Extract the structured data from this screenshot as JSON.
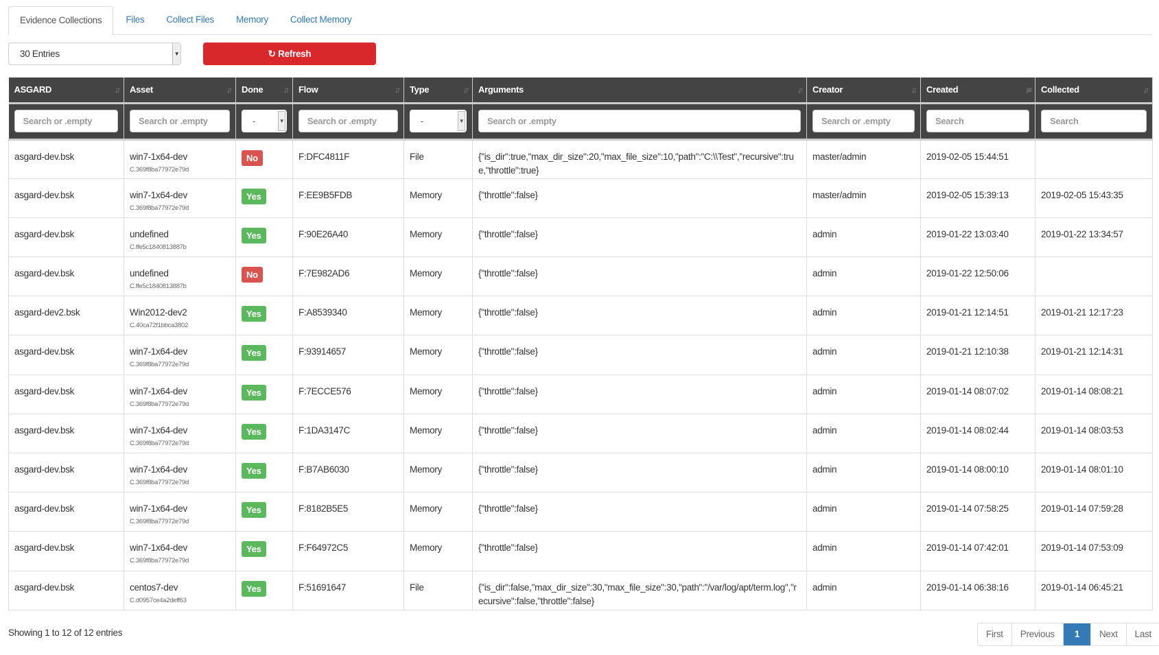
{
  "tabs": [
    "Evidence Collections",
    "Files",
    "Collect Files",
    "Memory",
    "Collect Memory"
  ],
  "entries_select": "30 Entries",
  "refresh_label": "Refresh",
  "columns": [
    "ASGARD",
    "Asset",
    "Done",
    "Flow",
    "Type",
    "Arguments",
    "Creator",
    "Created",
    "Collected"
  ],
  "filters": [
    "Search or .empty",
    "Search or .empty",
    "-",
    "Search or .empty",
    "-",
    "Search or .empty",
    "Search or .empty",
    "Search",
    "Search"
  ],
  "rows": [
    {
      "asgard": "asgard-dev.bsk",
      "asset": "win7-1x64-dev",
      "client": "C.369f8ba77972e79d",
      "done": "No",
      "flow": "F:DFC4811F",
      "type": "File",
      "args": "{\"is_dir\":true,\"max_dir_size\":20,\"max_file_size\":10,\"path\":\"C:\\\\Test\",\"recursive\":true,\"throttle\":true}",
      "creator": "master/admin",
      "created": "2019-02-05 15:44:51",
      "collected": ""
    },
    {
      "asgard": "asgard-dev.bsk",
      "asset": "win7-1x64-dev",
      "client": "C.369f8ba77972e79d",
      "done": "Yes",
      "flow": "F:EE9B5FDB",
      "type": "Memory",
      "args": "{\"throttle\":false}",
      "creator": "master/admin",
      "created": "2019-02-05 15:39:13",
      "collected": "2019-02-05 15:43:35"
    },
    {
      "asgard": "asgard-dev.bsk",
      "asset": "undefined",
      "client": "C.ffe5c1840813887b",
      "done": "Yes",
      "flow": "F:90E26A40",
      "type": "Memory",
      "args": "{\"throttle\":false}",
      "creator": "admin",
      "created": "2019-01-22 13:03:40",
      "collected": "2019-01-22 13:34:57"
    },
    {
      "asgard": "asgard-dev.bsk",
      "asset": "undefined",
      "client": "C.ffe5c1840813887b",
      "done": "No",
      "flow": "F:7E982AD6",
      "type": "Memory",
      "args": "{\"throttle\":false}",
      "creator": "admin",
      "created": "2019-01-22 12:50:06",
      "collected": ""
    },
    {
      "asgard": "asgard-dev2.bsk",
      "asset": "Win2012-dev2",
      "client": "C.40ca72f1bbca3802",
      "done": "Yes",
      "flow": "F:A8539340",
      "type": "Memory",
      "args": "{\"throttle\":false}",
      "creator": "admin",
      "created": "2019-01-21 12:14:51",
      "collected": "2019-01-21 12:17:23"
    },
    {
      "asgard": "asgard-dev.bsk",
      "asset": "win7-1x64-dev",
      "client": "C.369f8ba77972e79d",
      "done": "Yes",
      "flow": "F:93914657",
      "type": "Memory",
      "args": "{\"throttle\":false}",
      "creator": "admin",
      "created": "2019-01-21 12:10:38",
      "collected": "2019-01-21 12:14:31"
    },
    {
      "asgard": "asgard-dev.bsk",
      "asset": "win7-1x64-dev",
      "client": "C.369f8ba77972e79d",
      "done": "Yes",
      "flow": "F:7ECCE576",
      "type": "Memory",
      "args": "{\"throttle\":false}",
      "creator": "admin",
      "created": "2019-01-14 08:07:02",
      "collected": "2019-01-14 08:08:21"
    },
    {
      "asgard": "asgard-dev.bsk",
      "asset": "win7-1x64-dev",
      "client": "C.369f8ba77972e79d",
      "done": "Yes",
      "flow": "F:1DA3147C",
      "type": "Memory",
      "args": "{\"throttle\":false}",
      "creator": "admin",
      "created": "2019-01-14 08:02:44",
      "collected": "2019-01-14 08:03:53"
    },
    {
      "asgard": "asgard-dev.bsk",
      "asset": "win7-1x64-dev",
      "client": "C.369f8ba77972e79d",
      "done": "Yes",
      "flow": "F:B7AB6030",
      "type": "Memory",
      "args": "{\"throttle\":false}",
      "creator": "admin",
      "created": "2019-01-14 08:00:10",
      "collected": "2019-01-14 08:01:10"
    },
    {
      "asgard": "asgard-dev.bsk",
      "asset": "win7-1x64-dev",
      "client": "C.369f8ba77972e79d",
      "done": "Yes",
      "flow": "F:8182B5E5",
      "type": "Memory",
      "args": "{\"throttle\":false}",
      "creator": "admin",
      "created": "2019-01-14 07:58:25",
      "collected": "2019-01-14 07:59:28"
    },
    {
      "asgard": "asgard-dev.bsk",
      "asset": "win7-1x64-dev",
      "client": "C.369f8ba77972e79d",
      "done": "Yes",
      "flow": "F:F64972C5",
      "type": "Memory",
      "args": "{\"throttle\":false}",
      "creator": "admin",
      "created": "2019-01-14 07:42:01",
      "collected": "2019-01-14 07:53:09"
    },
    {
      "asgard": "asgard-dev.bsk",
      "asset": "centos7-dev",
      "client": "C.d0957ce4a2deff63",
      "done": "Yes",
      "flow": "F:51691647",
      "type": "File",
      "args": "{\"is_dir\":false,\"max_dir_size\":30,\"max_file_size\":30,\"path\":\"/var/log/apt/term.log\",\"recursive\":false,\"throttle\":false}",
      "creator": "admin",
      "created": "2019-01-14 06:38:16",
      "collected": "2019-01-14 06:45:21"
    }
  ],
  "info": "Showing 1 to 12 of 12 entries",
  "pager": [
    "First",
    "Previous",
    "1",
    "Next",
    "Last"
  ]
}
